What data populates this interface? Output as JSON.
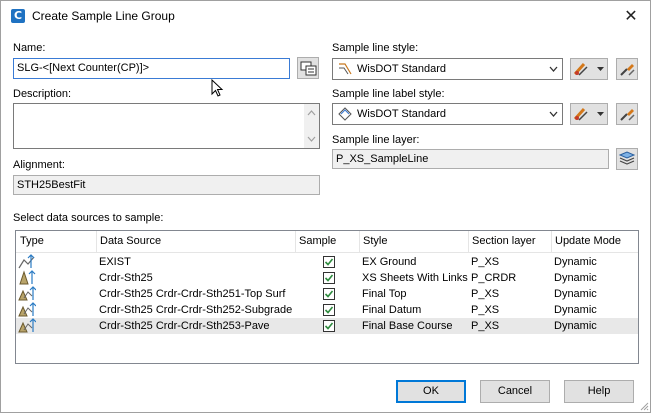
{
  "window": {
    "title": "Create Sample Line Group",
    "app_icon_letter": "C",
    "close_glyph": "✕"
  },
  "name": {
    "label": "Name:",
    "value": "SLG-<[Next Counter(CP)]>"
  },
  "description": {
    "label": "Description:",
    "value": ""
  },
  "alignment": {
    "label": "Alignment:",
    "value": "STH25BestFit"
  },
  "sample_line_style": {
    "label": "Sample line style:",
    "value": "WisDOT Standard"
  },
  "sample_line_label_style": {
    "label": "Sample line label style:",
    "value": "WisDOT Standard"
  },
  "sample_line_layer": {
    "label": "Sample line layer:",
    "value": "P_XS_SampleLine"
  },
  "data_sources": {
    "label": "Select data sources to sample:",
    "columns": [
      "Type",
      "Data Source",
      "Sample",
      "Style",
      "Section layer",
      "Update Mode"
    ],
    "rows": [
      {
        "data_source": "EXIST",
        "sample": true,
        "style": "EX Ground",
        "section_layer": "P_XS",
        "update_mode": "Dynamic"
      },
      {
        "data_source": "Crdr-Sth25",
        "sample": true,
        "style": "XS Sheets With Links",
        "section_layer": "P_CRDR",
        "update_mode": "Dynamic"
      },
      {
        "data_source": "Crdr-Sth25 Crdr-Crdr-Sth251-Top Surf",
        "sample": true,
        "style": "Final Top",
        "section_layer": "P_XS",
        "update_mode": "Dynamic"
      },
      {
        "data_source": "Crdr-Sth25 Crdr-Crdr-Sth252-Subgrade",
        "sample": true,
        "style": "Final Datum",
        "section_layer": "P_XS",
        "update_mode": "Dynamic"
      },
      {
        "data_source": "Crdr-Sth25 Crdr-Crdr-Sth253-Pave",
        "sample": true,
        "style": "Final Base Course",
        "section_layer": "P_XS",
        "update_mode": "Dynamic"
      }
    ]
  },
  "buttons": {
    "ok": "OK",
    "cancel": "Cancel",
    "help": "Help"
  },
  "colors": {
    "accent": "#0078d7",
    "check": "#2e8b3e",
    "app_icon": "#1f72c2"
  }
}
